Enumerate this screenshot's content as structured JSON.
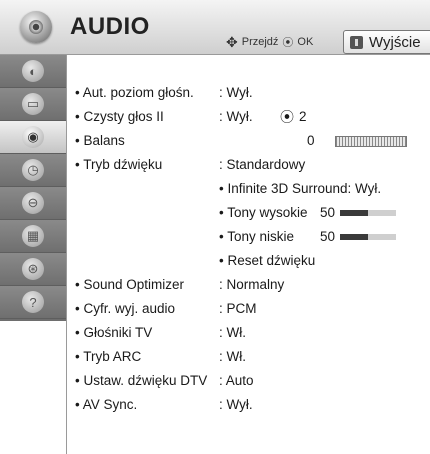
{
  "header": {
    "icon": "audio-speaker-icon",
    "title": "AUDIO",
    "hint_move": "Przejdź",
    "hint_ok": "OK",
    "exit_label": "Wyjście"
  },
  "sidebar": {
    "tabs": [
      {
        "icon": "picture-icon",
        "glyph": "◐"
      },
      {
        "icon": "screen-icon",
        "glyph": "▭"
      },
      {
        "icon": "audio-icon",
        "glyph": "◉"
      },
      {
        "icon": "clock-icon",
        "glyph": "◷"
      },
      {
        "icon": "lock-icon",
        "glyph": "⊖"
      },
      {
        "icon": "option-icon",
        "glyph": "▦"
      },
      {
        "icon": "network-icon",
        "glyph": "⊛"
      },
      {
        "icon": "help-icon",
        "glyph": "?"
      }
    ],
    "active_index": 2
  },
  "settings": {
    "auto_volume": {
      "label": "Aut. poziom głośn.",
      "value": ": Wył."
    },
    "clear_voice": {
      "label": "Czysty głos II",
      "value": ": Wył.",
      "level": "2"
    },
    "balance": {
      "label": "Balans",
      "value": "0"
    },
    "sound_mode": {
      "label": "Tryb dźwięku",
      "value": ": Standardowy"
    },
    "surround": {
      "label": "Infinite 3D Surround: Wył."
    },
    "treble": {
      "label": "Tony wysokie",
      "value": "50",
      "level": 0.5
    },
    "bass": {
      "label": "Tony niskie",
      "value": "50",
      "level": 0.5
    },
    "reset": {
      "label": "Reset dźwięku"
    },
    "sound_optimizer": {
      "label": "Sound Optimizer",
      "value": ": Normalny"
    },
    "digital_out": {
      "label": "Cyfr. wyj. audio",
      "value": ": PCM"
    },
    "tv_speakers": {
      "label": "Głośniki TV",
      "value": ": Wł."
    },
    "arc_mode": {
      "label": "Tryb ARC",
      "value": ": Wł."
    },
    "dtv_audio": {
      "label": "Ustaw. dźwięku DTV",
      "value": ": Auto"
    },
    "av_sync": {
      "label": "AV Sync.",
      "value": ": Wył."
    }
  }
}
